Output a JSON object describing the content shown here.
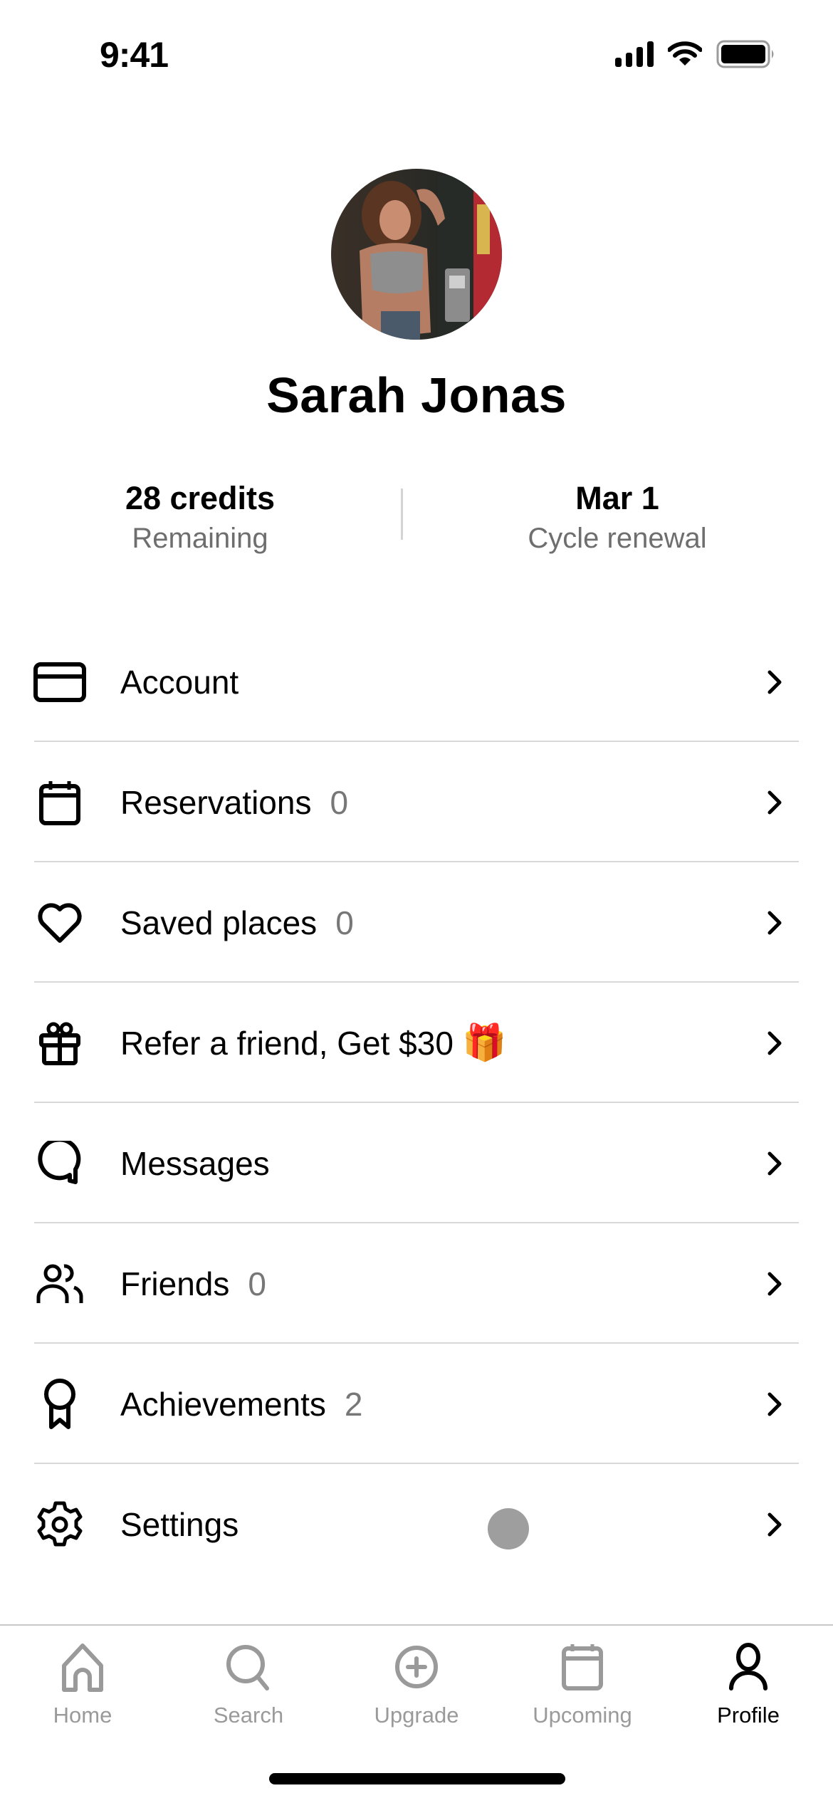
{
  "status_bar": {
    "time": "9:41",
    "icons": [
      "cellular-signal-icon",
      "wifi-icon",
      "battery-icon"
    ]
  },
  "profile": {
    "name": "Sarah Jonas",
    "avatar_alt": "Profile photo"
  },
  "stats": {
    "credits": {
      "value": "28 credits",
      "label": "Remaining"
    },
    "renewal": {
      "value": "Mar 1",
      "label": "Cycle renewal"
    }
  },
  "menu": {
    "items": [
      {
        "label": "Account",
        "count": null,
        "icon": "credit-card-icon"
      },
      {
        "label": "Reservations",
        "count": "0",
        "icon": "calendar-icon"
      },
      {
        "label": "Saved places",
        "count": "0",
        "icon": "heart-icon"
      },
      {
        "label": "Refer a friend, Get $30",
        "count": null,
        "emoji": "🎁",
        "icon": "gift-icon"
      },
      {
        "label": "Messages",
        "count": null,
        "icon": "chat-bubble-icon"
      },
      {
        "label": "Friends",
        "count": "0",
        "icon": "users-icon"
      },
      {
        "label": "Achievements",
        "count": "2",
        "icon": "award-ribbon-icon"
      },
      {
        "label": "Settings",
        "count": null,
        "icon": "gear-icon"
      }
    ]
  },
  "tab_bar": {
    "tabs": [
      {
        "label": "Home",
        "icon": "home-icon",
        "active": false
      },
      {
        "label": "Search",
        "icon": "search-icon",
        "active": false
      },
      {
        "label": "Upgrade",
        "icon": "plus-circle-icon",
        "active": false
      },
      {
        "label": "Upcoming",
        "icon": "calendar-icon",
        "active": false
      },
      {
        "label": "Profile",
        "icon": "person-icon",
        "active": true
      }
    ]
  },
  "colors": {
    "text_primary": "#000000",
    "text_secondary": "#6e6e6e",
    "tab_inactive": "#9a9a9a",
    "divider": "#d8d8d8"
  }
}
